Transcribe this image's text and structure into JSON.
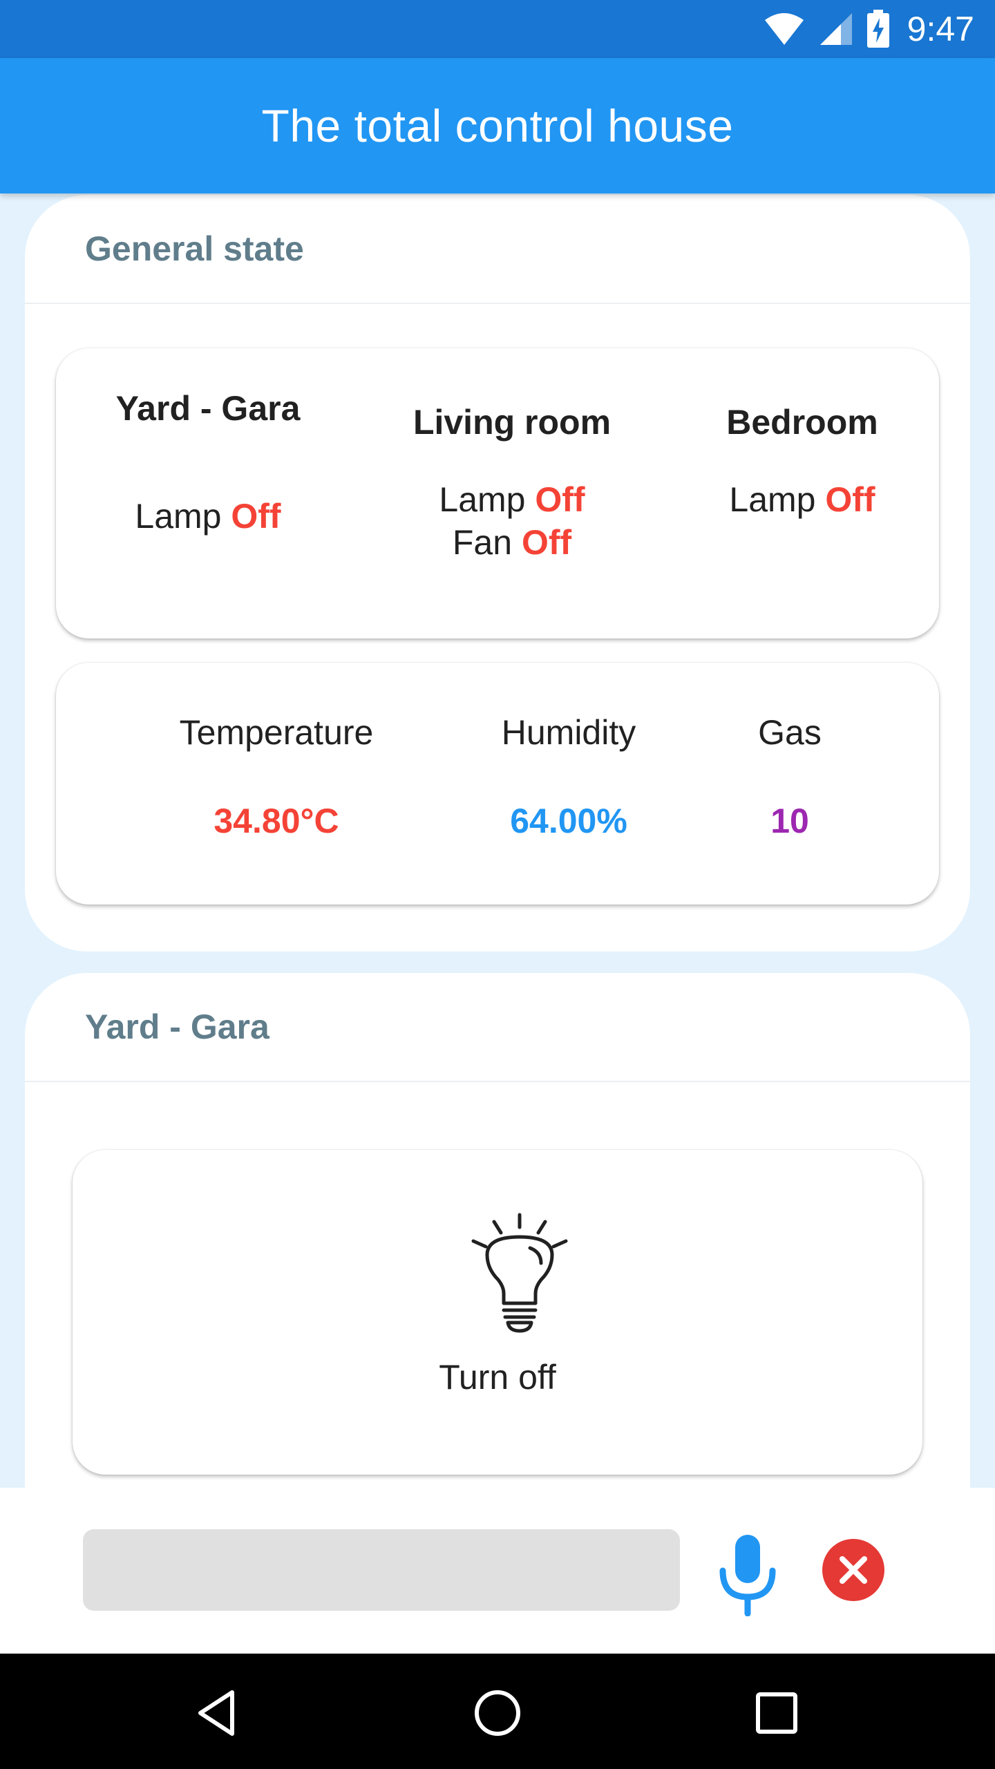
{
  "status_bar": {
    "time": "9:47",
    "icons": [
      "wifi-icon",
      "signal-icon",
      "battery-charging-icon"
    ]
  },
  "app_bar": {
    "title": "The total control house"
  },
  "general": {
    "title": "General state",
    "rooms": [
      {
        "name": "Yard - Gara",
        "devices": [
          {
            "label": "Lamp",
            "state": "Off"
          }
        ]
      },
      {
        "name": "Living room",
        "devices": [
          {
            "label": "Lamp",
            "state": "Off"
          },
          {
            "label": "Fan",
            "state": "Off"
          }
        ]
      },
      {
        "name": "Bedroom",
        "devices": [
          {
            "label": "Lamp",
            "state": "Off"
          }
        ]
      }
    ],
    "sensors": [
      {
        "label": "Temperature",
        "value": "34.80°C",
        "color": "#f44336"
      },
      {
        "label": "Humidity",
        "value": "64.00%",
        "color": "#2196f3"
      },
      {
        "label": "Gas",
        "value": "10",
        "color": "#9c27b0"
      }
    ]
  },
  "yard_section": {
    "title": "Yard - Gara",
    "device": {
      "icon": "lightbulb-icon",
      "action_label": "Turn off"
    }
  },
  "input_bar": {
    "text_value": "",
    "mic_icon": "microphone-icon",
    "close_icon": "close-icon",
    "accent_color": "#2196f3",
    "close_color": "#e53935"
  },
  "nav_bar": {
    "buttons": [
      "back-icon",
      "home-icon",
      "recents-icon"
    ]
  },
  "colors": {
    "status_bar": "#1976d2",
    "app_bar": "#2196f3",
    "background": "#e3f2fd",
    "section_title": "#607d8b",
    "off_state": "#f44336"
  }
}
